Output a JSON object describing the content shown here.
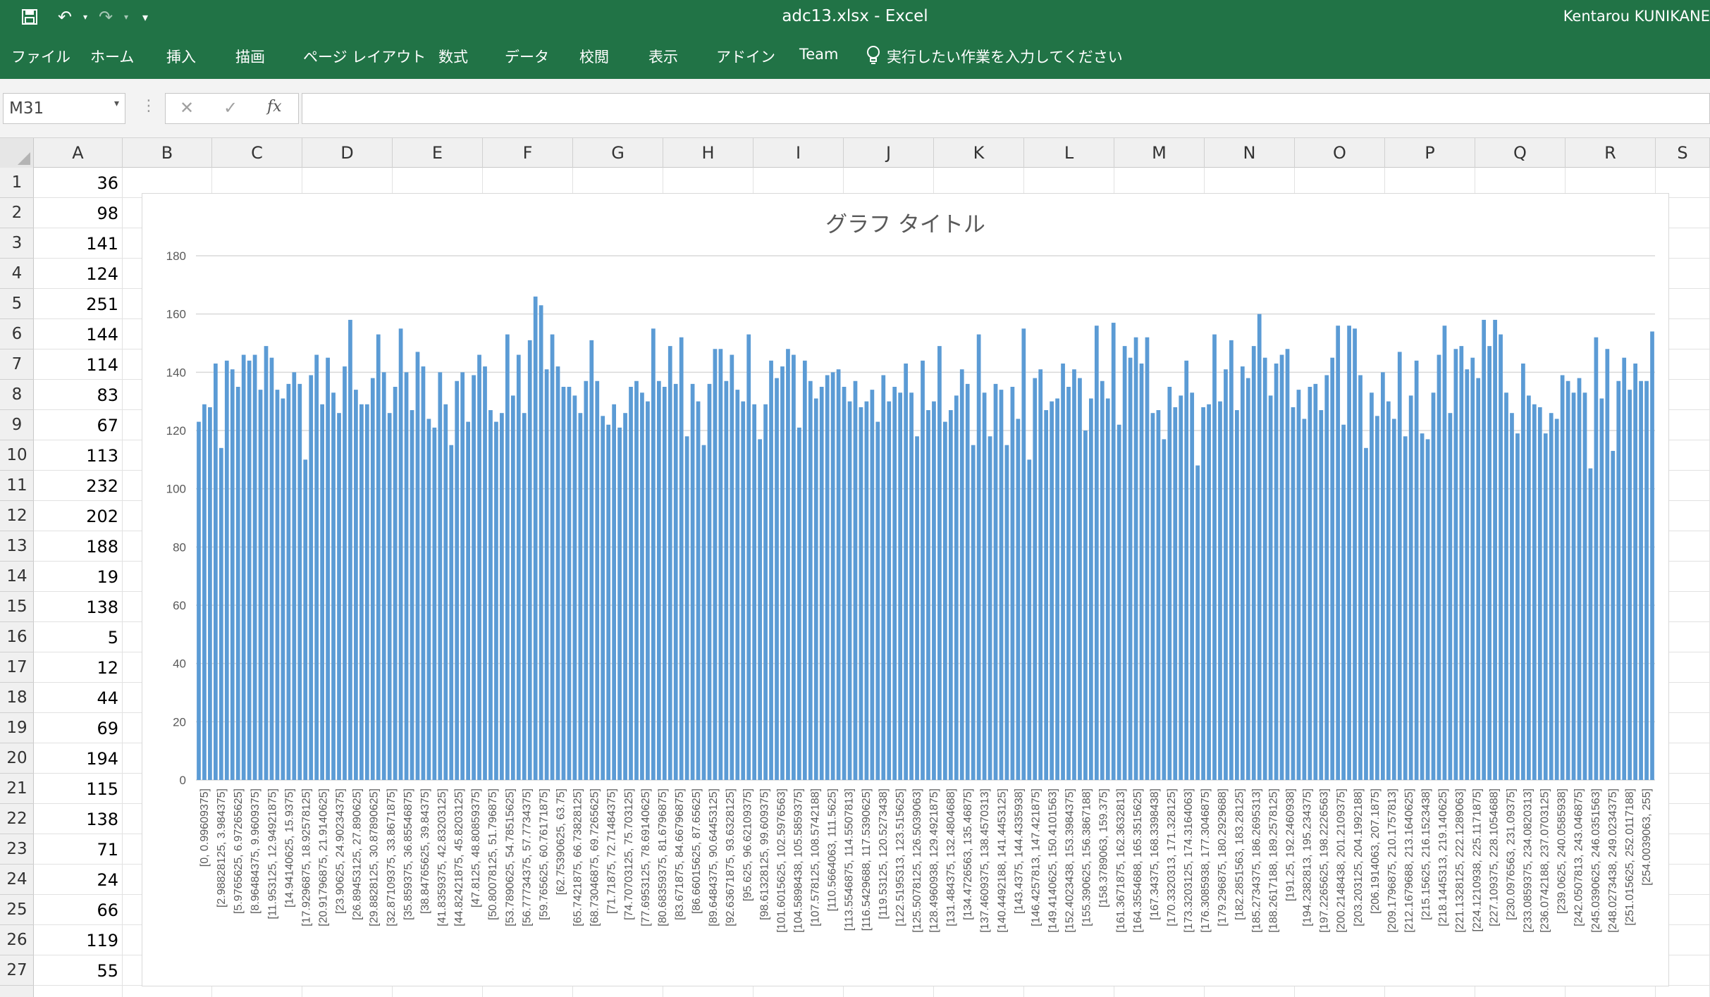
{
  "titlebar": {
    "document_title": "adc13.xlsx  -  Excel",
    "user_name": "Kentarou KUNIKANE",
    "quick_access": [
      {
        "icon": "save-icon",
        "glyph": "💾"
      },
      {
        "icon": "undo-icon",
        "glyph": "↶"
      },
      {
        "icon": "redo-icon",
        "glyph": "↷"
      },
      {
        "icon": "customize-quick-access-icon",
        "glyph": "▾"
      }
    ],
    "accent_color": "#217346"
  },
  "ribbon": {
    "tabs": [
      "ファイル",
      "ホーム",
      "挿入",
      "描画",
      "ページ レイアウト",
      "数式",
      "データ",
      "校閲",
      "表示",
      "アドイン",
      "Team"
    ],
    "tell_me": "実行したい作業を入力してください"
  },
  "formula_bar": {
    "name_box": "M31",
    "cancel_glyph": "✕",
    "enter_glyph": "✓",
    "fx_label": "fx",
    "formula": ""
  },
  "grid": {
    "columns": [
      "A",
      "B",
      "C",
      "D",
      "E",
      "F",
      "G",
      "H",
      "I",
      "J",
      "K",
      "L",
      "M",
      "N",
      "O",
      "P",
      "Q",
      "R",
      "S"
    ],
    "rows": [
      "1",
      "2",
      "3",
      "4",
      "5",
      "6",
      "7",
      "8",
      "9",
      "10",
      "11",
      "12",
      "13",
      "14",
      "15",
      "16",
      "17",
      "18",
      "19",
      "20",
      "21",
      "22",
      "23",
      "24",
      "25",
      "26",
      "27"
    ],
    "column_a_values": [
      "36",
      "98",
      "141",
      "124",
      "251",
      "144",
      "114",
      "83",
      "67",
      "113",
      "232",
      "202",
      "188",
      "19",
      "138",
      "5",
      "12",
      "44",
      "69",
      "194",
      "115",
      "138",
      "71",
      "24",
      "66",
      "119",
      "55"
    ]
  },
  "chart_data": {
    "type": "bar",
    "title": "グラフ タイトル",
    "bar_color": "#5b9bd5",
    "grid": true,
    "ylim": [
      0,
      180
    ],
    "yticks": [
      "0",
      "20",
      "40",
      "60",
      "80",
      "100",
      "120",
      "140",
      "160",
      "180"
    ],
    "categories": [
      "[0, 0.99609375]",
      "[2.98828125, 3.984375]",
      "[5.9765625, 6.97265625]",
      "[8.96484375, 9.9609375]",
      "[11.953125, 12.94921875]",
      "[14.94140625, 15.9375]",
      "[17.9296875, 18.92578125]",
      "[20.91796875, 21.9140625]",
      "[23.90625, 24.90234375]",
      "[26.89453125, 27.890625]",
      "[29.8828125, 30.87890625]",
      "[32.87109375, 33.8671875]",
      "[35.859375, 36.85546875]",
      "[38.84765625, 39.84375]",
      "[41.8359375, 42.83203125]",
      "[44.82421875, 45.8203125]",
      "[47.8125, 48.80859375]",
      "[50.80078125, 51.796875]",
      "[53.7890625, 54.78515625]",
      "[56.77734375, 57.7734375]",
      "[59.765625, 60.76171875]",
      "[62.75390625, 63.75]",
      "[65.7421875, 66.73828125]",
      "[68.73046875, 69.7265625]",
      "[71.71875, 72.71484375]",
      "[74.70703125, 75.703125]",
      "[77.6953125, 78.69140625]",
      "[80.68359375, 81.6796875]",
      "[83.671875, 84.66796875]",
      "[86.66015625, 87.65625]",
      "[89.6484375, 90.64453125]",
      "[92.63671875, 93.6328125]",
      "[95.625, 96.62109375]",
      "[98.61328125, 99.609375]",
      "[101.6015625, 102.5976563]",
      "[104.5898438, 105.5859375]",
      "[107.578125, 108.5742188]",
      "[110.5664063, 111.5625]",
      "[113.5546875, 114.5507813]",
      "[116.5429688, 117.5390625]",
      "[119.53125, 120.5273438]",
      "[122.5195313, 123.515625]",
      "[125.5078125, 126.5039063]",
      "[128.4960938, 129.4921875]",
      "[131.484375, 132.4804688]",
      "[134.4726563, 135.46875]",
      "[137.4609375, 138.4570313]",
      "[140.4492188, 141.4453125]",
      "[143.4375, 144.4335938]",
      "[146.4257813, 147.421875]",
      "[149.4140625, 150.4101563]",
      "[152.4023438, 153.3984375]",
      "[155.390625, 156.3867188]",
      "[158.3789063, 159.375]",
      "[161.3671875, 162.3632813]",
      "[164.3554688, 165.3515625]",
      "[167.34375, 168.3398438]",
      "[170.3320313, 171.328125]",
      "[173.3203125, 174.3164063]",
      "[176.3085938, 177.3046875]",
      "[179.296875, 180.2929688]",
      "[182.2851563, 183.28125]",
      "[185.2734375, 186.2695313]",
      "[188.2617188, 189.2578125]",
      "[191.25, 192.2460938]",
      "[194.2382813, 195.234375]",
      "[197.2265625, 198.2226563]",
      "[200.2148438, 201.2109375]",
      "[203.203125, 204.1992188]",
      "[206.1914063, 207.1875]",
      "[209.1796875, 210.1757813]",
      "[212.1679688, 213.1640625]",
      "[215.15625, 216.1523438]",
      "[218.1445313, 219.140625]",
      "[221.1328125, 222.1289063]",
      "[224.1210938, 225.1171875]",
      "[227.109375, 228.1054688]",
      "[230.0976563, 231.09375]",
      "[233.0859375, 234.0820313]",
      "[236.0742188, 237.0703125]",
      "[239.0625, 240.0585938]",
      "[242.0507813, 243.046875]",
      "[245.0390625, 246.0351563]",
      "[248.0273438, 249.0234375]",
      "[251.015625, 252.0117188]",
      "[254.0039063, 255]"
    ],
    "values": [
      123,
      129,
      128,
      143,
      114,
      144,
      141,
      135,
      146,
      144,
      146,
      134,
      149,
      145,
      134,
      131,
      136,
      140,
      136,
      110,
      139,
      146,
      129,
      145,
      133,
      126,
      142,
      158,
      134,
      129,
      129,
      138,
      153,
      140,
      126,
      135,
      155,
      140,
      127,
      147,
      142,
      124,
      121,
      140,
      129,
      115,
      137,
      140,
      123,
      139,
      146,
      142,
      127,
      123,
      126,
      153,
      132,
      146,
      126,
      151,
      166,
      163,
      141,
      153,
      142,
      135,
      135,
      132,
      126,
      137,
      151,
      137,
      125,
      122,
      129,
      121,
      126,
      135,
      137,
      133,
      130,
      155,
      137,
      135,
      149,
      136,
      152,
      118,
      136,
      130,
      115,
      136,
      148,
      148,
      137,
      146,
      134,
      130,
      153,
      129,
      117,
      129,
      144,
      138,
      142,
      148,
      146,
      121,
      144,
      137,
      131,
      135,
      139,
      140,
      141,
      135,
      130,
      137,
      128,
      130,
      134,
      123,
      139,
      130,
      135,
      133,
      143,
      133,
      118,
      144,
      127,
      130,
      149,
      123,
      127,
      132,
      141,
      136,
      115,
      153,
      133,
      118,
      136,
      134,
      115,
      135,
      124,
      155,
      110,
      138,
      141,
      127,
      130,
      131,
      143,
      135,
      141,
      138,
      120,
      131,
      156,
      137,
      131,
      157,
      122,
      149,
      145,
      152,
      143,
      152,
      126,
      127,
      117,
      135,
      128,
      132,
      144,
      133,
      108,
      128,
      129,
      153,
      130,
      141,
      151,
      127,
      142,
      138,
      149,
      160,
      145,
      132,
      143,
      146,
      148,
      128,
      134,
      124,
      135,
      136,
      127,
      139,
      145,
      156,
      122,
      156,
      155,
      139,
      114,
      133,
      125,
      140,
      130,
      124,
      147,
      118,
      132,
      144,
      119,
      117,
      133,
      146,
      156,
      126,
      148,
      149,
      141,
      145,
      138,
      158,
      149,
      158,
      153,
      133,
      126,
      119,
      143,
      132,
      129,
      128,
      119,
      126,
      124,
      139,
      137,
      133,
      138,
      133,
      107,
      152,
      131,
      148,
      113,
      137,
      145,
      134,
      143,
      137,
      137,
      154
    ]
  }
}
